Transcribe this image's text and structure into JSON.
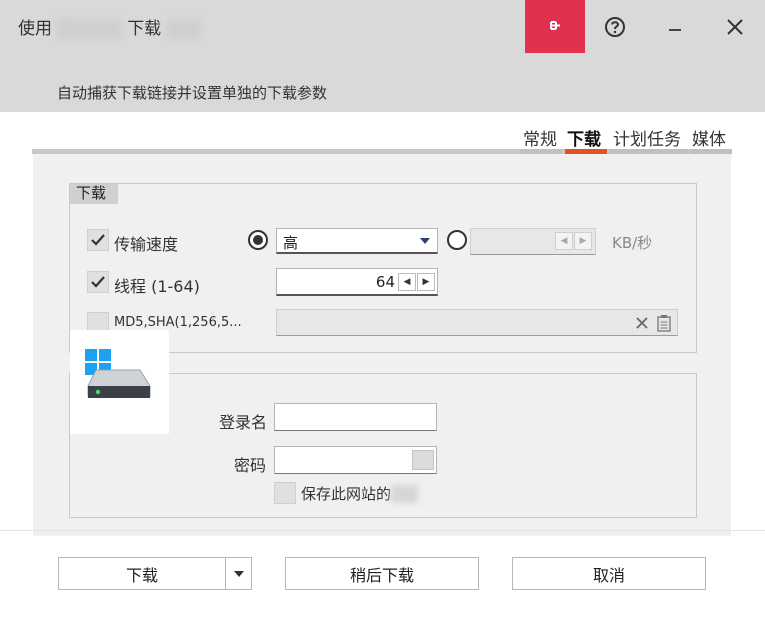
{
  "window": {
    "title_prefix": "使用",
    "title_blur1": "xxxxxx",
    "title_mid": "下载",
    "title_blur2": "xxx",
    "subtitle": "自动捕获下载链接并设置单独的下载参数"
  },
  "titlebar_icons": [
    "pin-icon",
    "help-icon",
    "minimize-icon",
    "close-icon"
  ],
  "colors": {
    "accent": "#e2304f",
    "tab_active": "#e2541f",
    "header_bg": "#d9d9d9",
    "panel_bg": "#f0f0f0"
  },
  "tabs": [
    {
      "label": "常规",
      "active": false
    },
    {
      "label": "下载",
      "active": true
    },
    {
      "label": "计划任务",
      "active": false
    },
    {
      "label": "媒体",
      "active": false
    }
  ],
  "download_group": {
    "legend": "下载",
    "speed": {
      "label": "传输速度",
      "checked": true,
      "preset_selected": true,
      "preset_value": "高",
      "custom_value": "",
      "unit": "KB/秒"
    },
    "threads": {
      "label": "线程 (1-64)",
      "checked": true,
      "value": "64"
    },
    "hash": {
      "label": "MD5,SHA(1,256,5...",
      "checked": false,
      "value": ""
    }
  },
  "login_group": {
    "username_label": "登录名",
    "username_value": "",
    "password_label": "密码",
    "password_value": "",
    "save_label": "保存此网站的",
    "save_blur": "xxx",
    "save_checked": false
  },
  "buttons": {
    "download": "下载",
    "download_later": "稍后下载",
    "cancel": "取消"
  }
}
